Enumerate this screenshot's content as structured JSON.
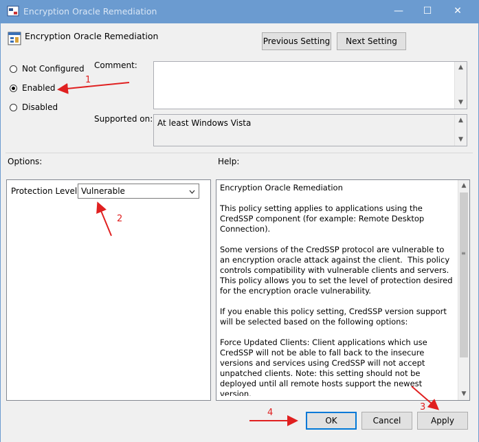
{
  "window": {
    "title": "Encryption Oracle Remediation",
    "minimize_glyph": "—",
    "maximize_glyph": "☐",
    "close_glyph": "✕"
  },
  "header": {
    "title": "Encryption Oracle Remediation",
    "previous_label": "Previous Setting",
    "next_label": "Next Setting"
  },
  "state": {
    "options": [
      {
        "label": "Not Configured",
        "checked": false
      },
      {
        "label": "Enabled",
        "checked": true
      },
      {
        "label": "Disabled",
        "checked": false
      }
    ]
  },
  "comment": {
    "label": "Comment:",
    "value": ""
  },
  "supported": {
    "label": "Supported on:",
    "value": "At least Windows Vista"
  },
  "options_section": {
    "label": "Options:",
    "protection_label": "Protection Level:",
    "protection_value": "Vulnerable"
  },
  "help": {
    "label": "Help:",
    "text": "Encryption Oracle Remediation\n\nThis policy setting applies to applications using the CredSSP component (for example: Remote Desktop Connection).\n\nSome versions of the CredSSP protocol are vulnerable to an encryption oracle attack against the client.  This policy controls compatibility with vulnerable clients and servers.  This policy allows you to set the level of protection desired for the encryption oracle vulnerability.\n\nIf you enable this policy setting, CredSSP version support will be selected based on the following options:\n\nForce Updated Clients: Client applications which use CredSSP will not be able to fall back to the insecure versions and services using CredSSP will not accept unpatched clients. Note: this setting should not be deployed until all remote hosts support the newest version.\n\nMitigated: Client applications which use CredSSP will not be able"
  },
  "footer": {
    "ok_label": "OK",
    "cancel_label": "Cancel",
    "apply_label": "Apply"
  },
  "annotations": {
    "n1": "1",
    "n2": "2",
    "n3": "3",
    "n4": "4",
    "color": "#e02020"
  },
  "colors": {
    "titlebar": "#6b9bd0",
    "accent": "#0078d7"
  }
}
